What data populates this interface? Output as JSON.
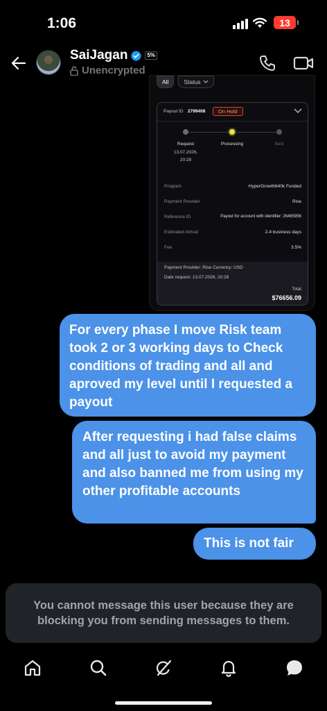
{
  "status_bar": {
    "time": "1:06",
    "battery": "13"
  },
  "header": {
    "name": "SaiJagan",
    "tag": "5%",
    "subtitle": "Unencrypted"
  },
  "screenshot": {
    "filters": [
      "All",
      "Status"
    ],
    "payout_id_label": "Payout ID",
    "payout_id": "2799408",
    "status": "On Hold",
    "steps": [
      {
        "label": "Request",
        "sub1": "13.07.2026,",
        "sub2": "20:28"
      },
      {
        "label": "Processing",
        "sub1": "",
        "sub2": ""
      },
      {
        "label": "Sent",
        "sub1": "",
        "sub2": ""
      }
    ],
    "rows": [
      {
        "label": "Program",
        "value": "HyperGrowth640k Funded"
      },
      {
        "label": "Payment Provider",
        "value": "Rise"
      },
      {
        "label": "Reference ID",
        "value": "Payout for account with identifier: 26465956"
      },
      {
        "label": "Estimated Arrival",
        "value": "2-4 business days"
      },
      {
        "label": "Fee",
        "value": "3.5%"
      }
    ],
    "footer_line1": "Payment Provider: Rise   Currency: USD",
    "footer_line2": "Date request: 13.07.2026, 20:28",
    "total_label": "Total",
    "total_value": "$76656.09"
  },
  "messages": [
    "For every phase I move Risk team took 2 or 3 working days to Check conditions of trading and all and aproved my level until I requested a payout",
    "After requesting i had false claims and all just to avoid my payment and also banned me from using my other profitable accounts",
    "This is not fair"
  ],
  "blocked_notice": "You cannot message this user because they are blocking you from sending messages to them.",
  "colors": {
    "bubble": "#4b92e8",
    "background": "#000000",
    "verified": "#1d9bf0",
    "on_hold": "#d9482f"
  },
  "tabs": [
    "home-icon",
    "search-icon",
    "grok-icon",
    "notifications-icon",
    "messages-icon"
  ]
}
